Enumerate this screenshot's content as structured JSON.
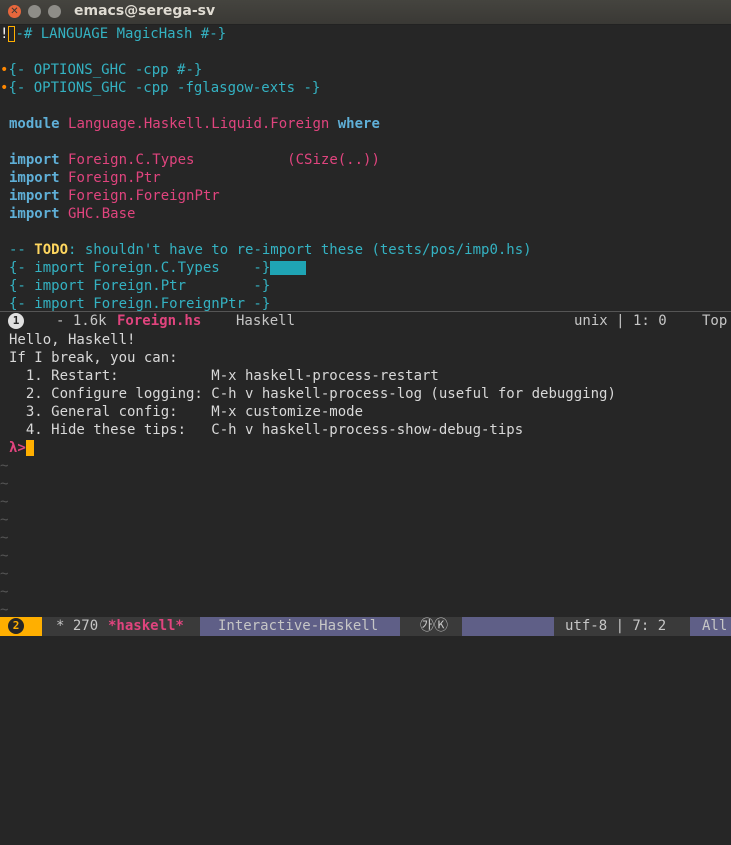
{
  "window": {
    "title": "emacs@serega-sv"
  },
  "editor": {
    "lines": {
      "l1": "-# LANGUAGE MagicHash #-}",
      "l3": "{- OPTIONS_GHC -cpp #-}",
      "l4": "{- OPTIONS_GHC -cpp -fglasgow-exts -}",
      "l6_kw": "module",
      "l6_mod": "Language.Haskell.Liquid.Foreign",
      "l6_kw2": "where",
      "imp": "import",
      "l8_mod": "Foreign.C.Types",
      "l8_rest": "(CSize(..))",
      "l9_mod": "Foreign.Ptr",
      "l10_mod": "Foreign.ForeignPtr",
      "l11_mod": "GHC.Base",
      "l13_a": "-- ",
      "l13_todo": "TODO",
      "l13_b": ": shouldn't have to re-import these (tests/pos/imp0.hs)",
      "l14": "{- import Foreign.C.Types    -}",
      "l15": "{- import Foreign.Ptr        -}",
      "l16": "{- import Foreign.ForeignPtr -}"
    }
  },
  "modeline1": {
    "badge": "1",
    "size": "- 1.6k",
    "buffer": "Foreign.hs",
    "mode": "Haskell",
    "encoding": "unix | 1: 0",
    "position": "Top"
  },
  "repl": {
    "l1": "Hello, Haskell!",
    "l2": "If I break, you can:",
    "l3": "  1. Restart:           M-x haskell-process-restart",
    "l4": "  2. Configure logging: C-h v haskell-process-log (useful for debugging)",
    "l5": "  3. General config:    M-x customize-mode",
    "l6": "  4. Hide these tips:   C-h v haskell-process-show-debug-tips",
    "prompt": "λ>",
    "tilde": "~"
  },
  "modeline2": {
    "badge": "2",
    "size": "* 270",
    "buffer": "*haskell*",
    "mode": "Interactive-Haskell",
    "icons": "㉮Ⓚ",
    "encoding": "utf-8 | 7: 2",
    "position": "All"
  },
  "colors": {
    "keyword": "#5fafd7",
    "module": "#e0447e",
    "comment": "#34b2c2",
    "accent": "#ffaf00",
    "purple": "#5f5f87"
  }
}
